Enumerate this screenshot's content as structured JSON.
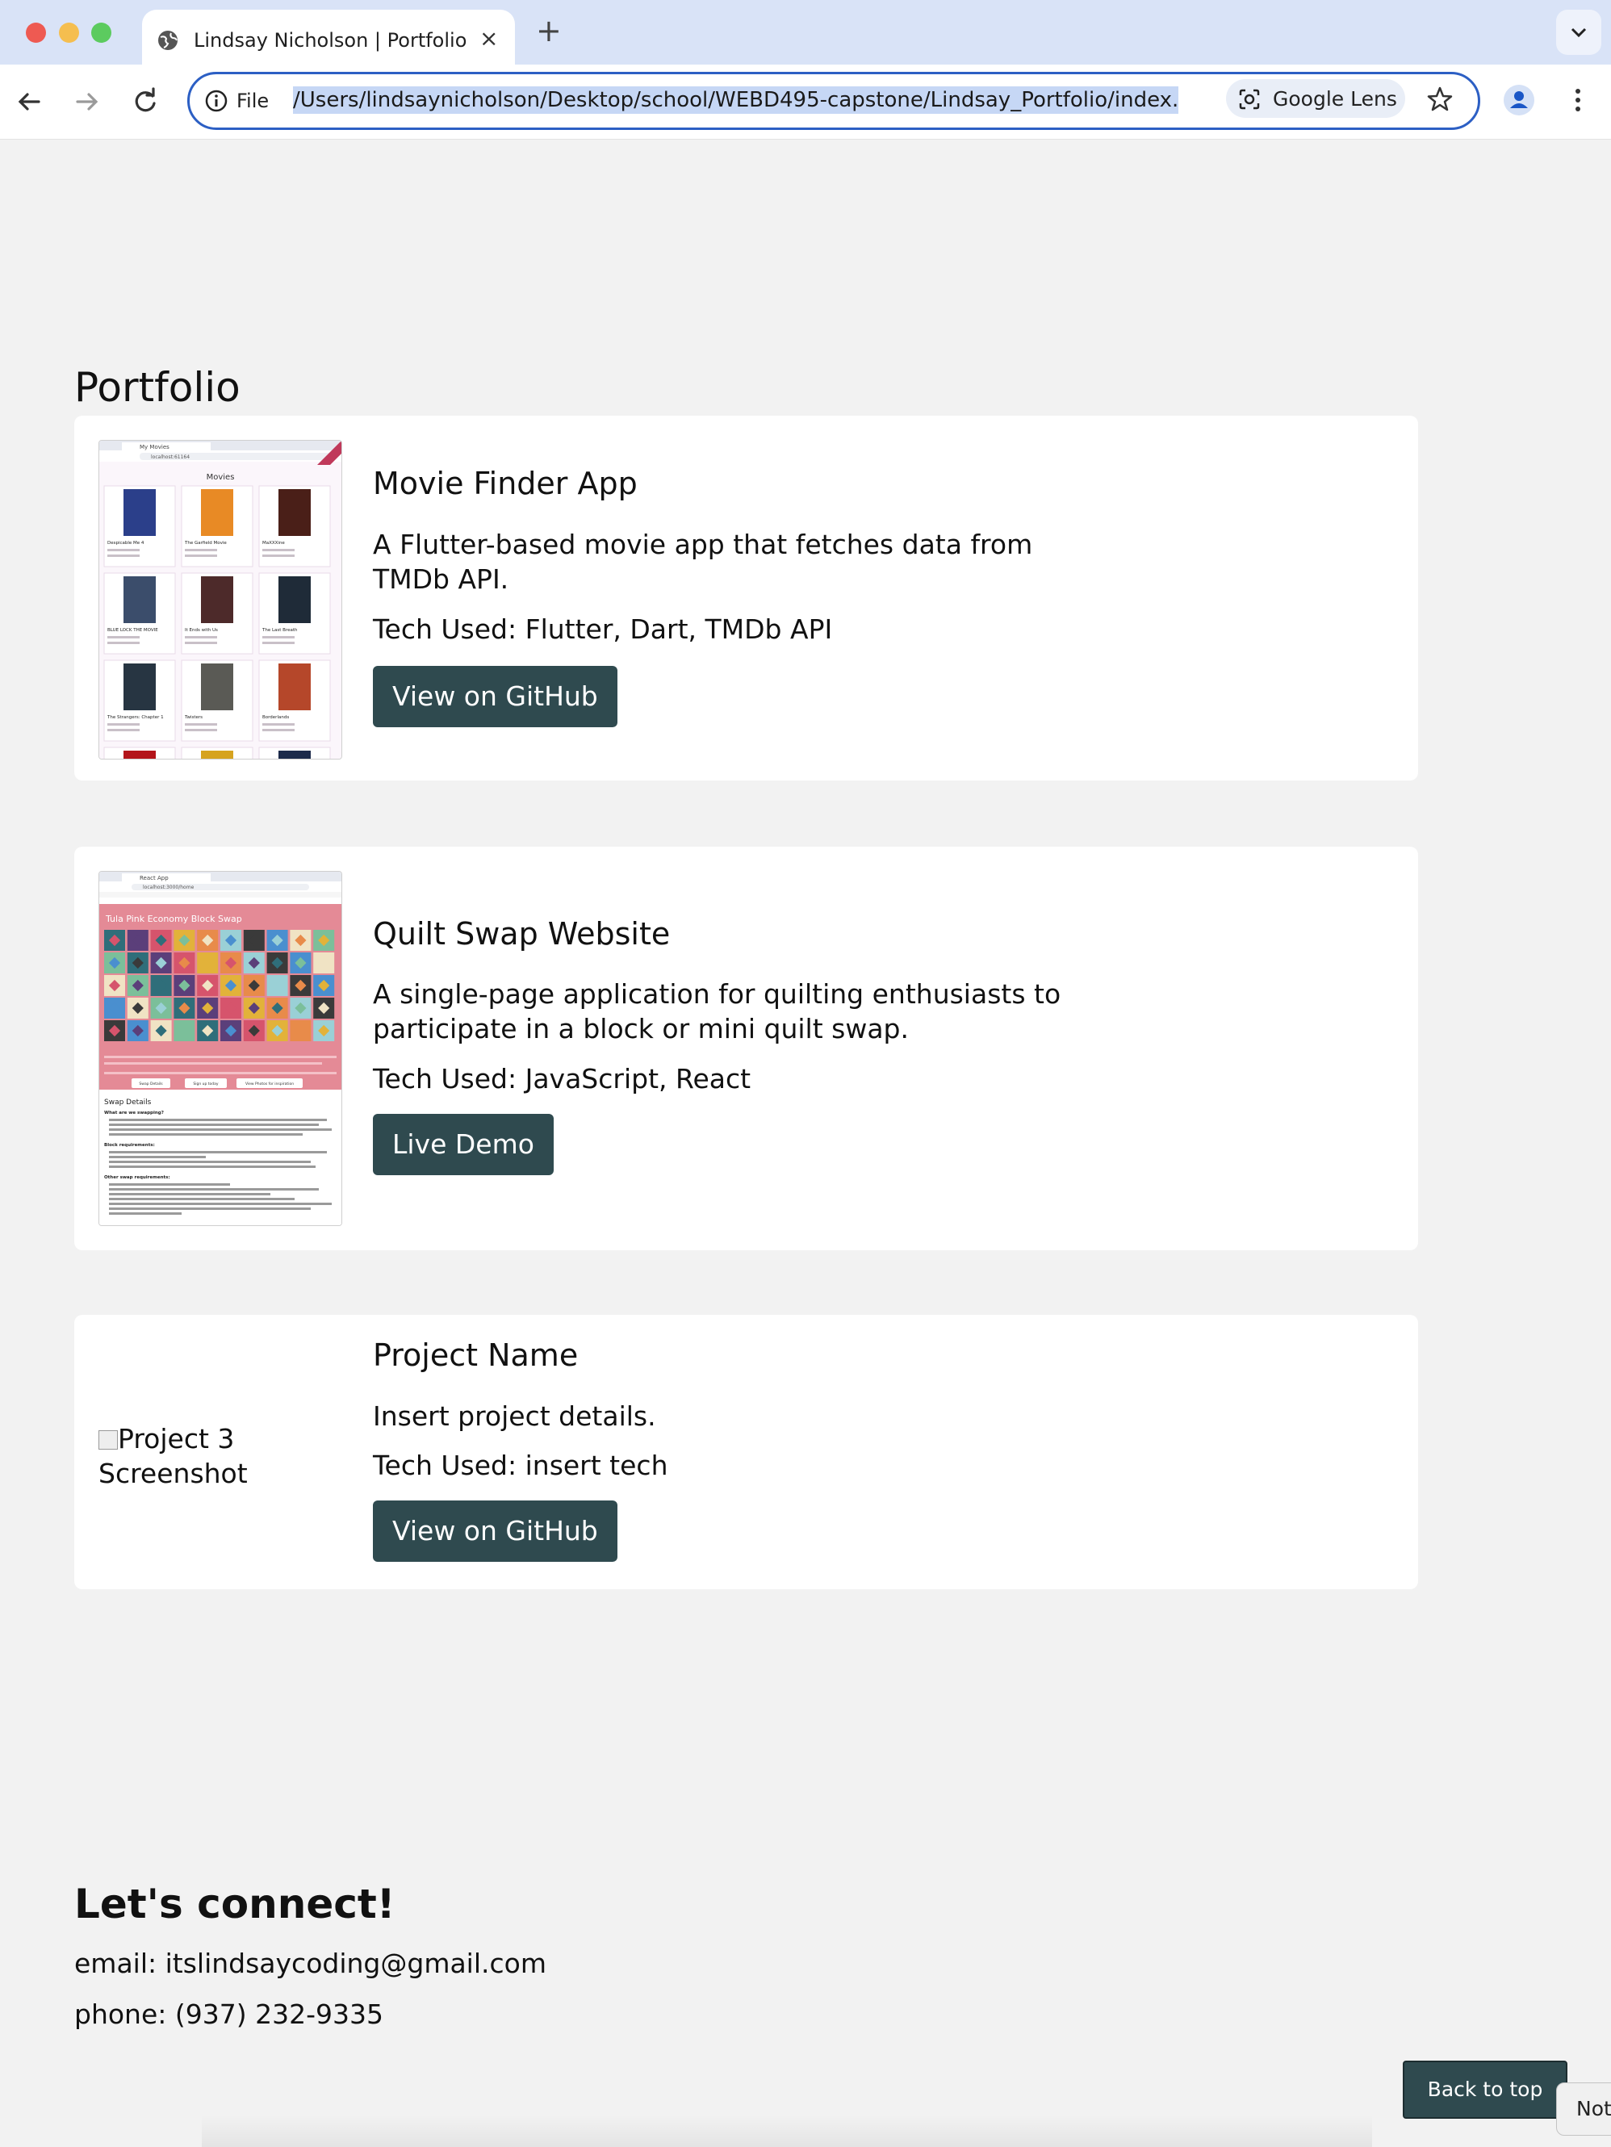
{
  "browser": {
    "tab_title": "Lindsay Nicholson | Portfolio",
    "tab_close": "×",
    "new_tab": "+",
    "scheme_label": "File",
    "url": "/Users/lindsaynicholson/Desktop/school/WEBD495-capstone/Lindsay_Portfolio/index.",
    "lens_label": "Google Lens",
    "accent": "#2c5fc4"
  },
  "portfolio": {
    "title": "Portfolio",
    "projects": [
      {
        "title": "Movie Finder App",
        "description": "A Flutter-based movie app that fetches data from TMDb API.",
        "tech": "Tech Used: Flutter, Dart, TMDb API",
        "button": "View on GitHub",
        "screenshot": {
          "heading": "Movies",
          "tab": "My Movies",
          "address": "localhost:61164",
          "movies": [
            {
              "name": "Despicable Me 4",
              "color": "#2b3f8a"
            },
            {
              "name": "The Garfield Movie",
              "color": "#e88a25"
            },
            {
              "name": "MaXXXine",
              "color": "#4a1f18"
            },
            {
              "name": "BLUE LOCK THE MOVIE",
              "color": "#3b4d6b"
            },
            {
              "name": "It Ends with Us",
              "color": "#4d2a2a"
            },
            {
              "name": "The Last Breath",
              "color": "#1f2b38"
            },
            {
              "name": "The Strangers: Chapter 1",
              "color": "#273542"
            },
            {
              "name": "Twisters",
              "color": "#5a5a55"
            },
            {
              "name": "Borderlands",
              "color": "#b5472a"
            },
            {
              "name": "",
              "color": "#b3141a"
            },
            {
              "name": "",
              "color": "#d6a31f"
            },
            {
              "name": "",
              "color": "#1c2a4a"
            }
          ]
        }
      },
      {
        "title": "Quilt Swap Website",
        "description": "A single-page application for quilting enthusiasts to participate in a block or mini quilt swap.",
        "tech": "Tech Used: JavaScript, React",
        "button": "Live Demo",
        "screenshot": {
          "banner": "Tula Pink Economy Block Swap",
          "tab": "React App",
          "address": "localhost:3000/home",
          "buttons": [
            "Swap Details",
            "Sign up today",
            "View Photos for inspiration"
          ],
          "section": "Swap Details",
          "subheads": [
            "What are we swapping?",
            "Block requirements:",
            "Other swap requirements:"
          ],
          "accent": "#e48a96"
        }
      },
      {
        "title": "Project Name",
        "description": "Insert project details.",
        "tech": "Tech Used: insert tech",
        "button": "View on GitHub",
        "screenshot_alt": "Project 3 Screenshot"
      }
    ]
  },
  "connect": {
    "title": "Let's connect!",
    "email": "email: itslindsaycoding@gmail.com",
    "phone": "phone: (937) 232-9335"
  },
  "back_to_top": "Back to top",
  "notification_peek": "Not",
  "colors": {
    "button": "#2f4a4f",
    "page_bg": "#f2f2f2",
    "card_bg": "#ffffff"
  }
}
